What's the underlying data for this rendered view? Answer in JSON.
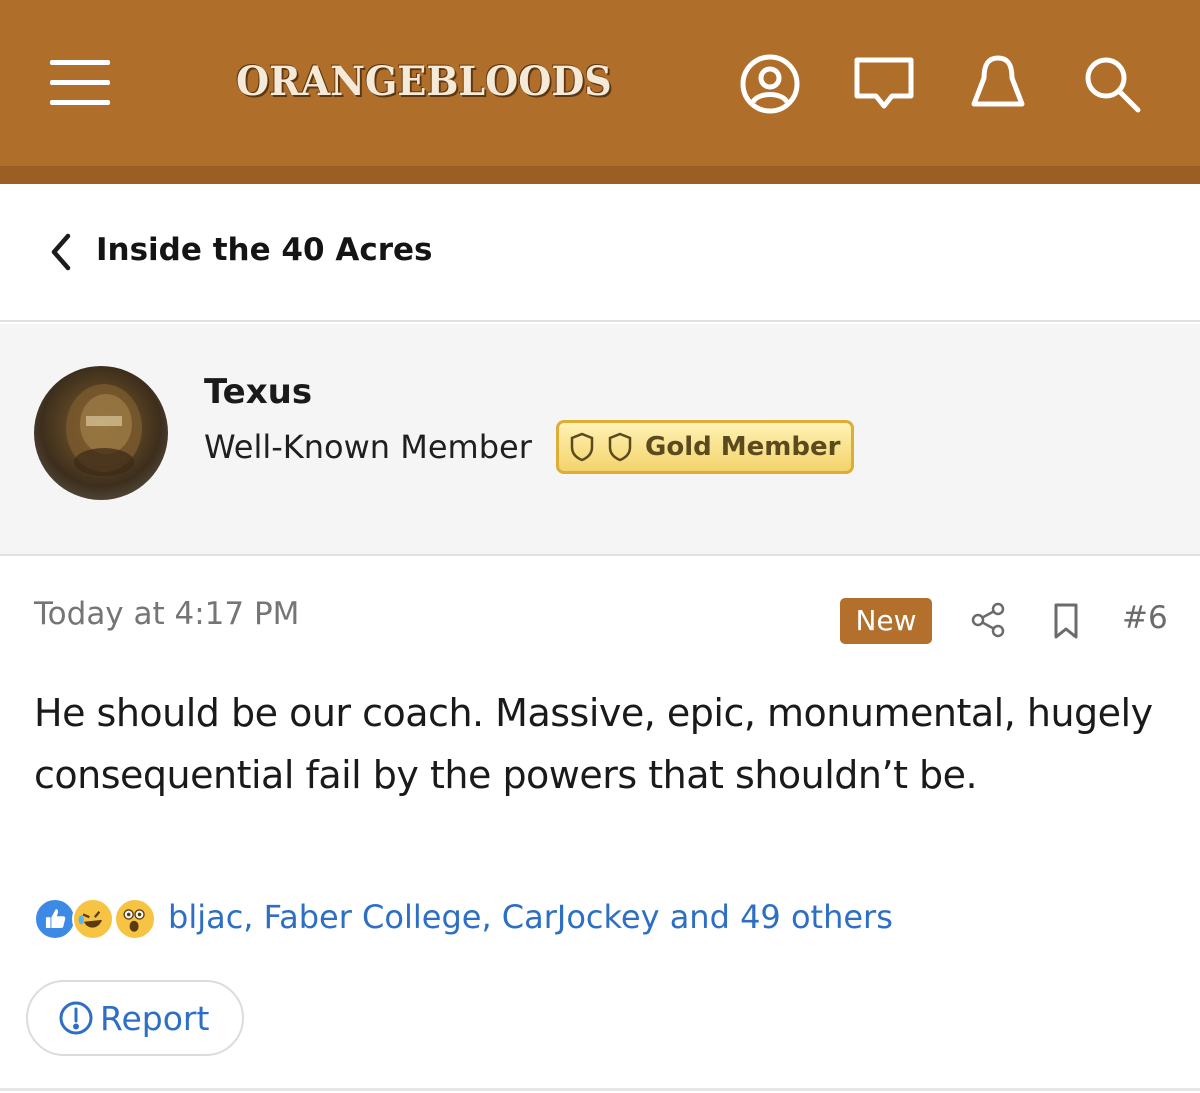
{
  "header": {
    "logo_text": "ORANGEBLOODS",
    "icons": [
      "menu-icon",
      "account-icon",
      "messages-icon",
      "alerts-icon",
      "search-icon"
    ],
    "background_color": "#b06e2b"
  },
  "breadcrumb": {
    "label": "Inside the 40 Acres"
  },
  "user": {
    "name": "Texus",
    "title": "Well-Known Member",
    "badge": "Gold Member"
  },
  "post": {
    "date": "Today at 4:17 PM",
    "new_label": "New",
    "number": "#6",
    "body": "He should be our coach. Massive, epic, monumental, hugely consequential fail by the powers that shouldn’t be.",
    "reaction_icons": [
      "like-icon",
      "laugh-icon",
      "wow-icon"
    ],
    "reactions_text": "bljac, Faber College, CarJockey and 49 others",
    "report_label": "Report"
  },
  "colors": {
    "accent": "#b06e2b",
    "link": "#2d6fc5",
    "new_badge": "#b2702c"
  }
}
